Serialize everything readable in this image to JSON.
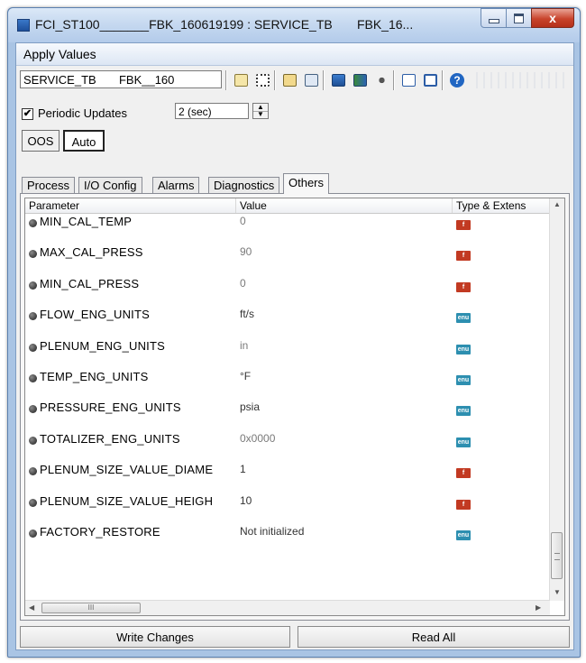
{
  "window": {
    "title": "FCI_ST100_______FBK_160619199 : SERVICE_TB       FBK_16...",
    "close_glyph": "x"
  },
  "menu": {
    "apply_values": "Apply Values"
  },
  "toolbar": {
    "block_name": "SERVICE_TB       FBK__160",
    "help_glyph": "?"
  },
  "periodic": {
    "checked_glyph": "✔",
    "label": "Periodic Updates",
    "interval": "2 (sec)"
  },
  "modes": {
    "oos": "OOS",
    "auto": "Auto"
  },
  "tabs": [
    "Process",
    "I/O Config",
    "Alarms",
    "Diagnostics",
    "Others"
  ],
  "active_tab": "Others",
  "grid": {
    "headers": {
      "parameter": "Parameter",
      "value": "Value",
      "type": "Type & Extens"
    },
    "rows": [
      {
        "name": "MIN_CAL_TEMP",
        "value": "0",
        "type": "f"
      },
      {
        "name": "MAX_CAL_PRESS",
        "value": "90",
        "type": "f"
      },
      {
        "name": "MIN_CAL_PRESS",
        "value": "0",
        "type": "f"
      },
      {
        "name": "FLOW_ENG_UNITS",
        "value": "ft/s",
        "type": "enu"
      },
      {
        "name": "PLENUM_ENG_UNITS",
        "value": "in",
        "type": "enu"
      },
      {
        "name": "TEMP_ENG_UNITS",
        "value": "°F",
        "type": "enu"
      },
      {
        "name": "PRESSURE_ENG_UNITS",
        "value": "psia",
        "type": "enu"
      },
      {
        "name": "TOTALIZER_ENG_UNITS",
        "value": "0x0000",
        "type": "enu"
      },
      {
        "name": "PLENUM_SIZE_VALUE_DIAME",
        "value": "1",
        "type": "f"
      },
      {
        "name": "PLENUM_SIZE_VALUE_HEIGH",
        "value": "10",
        "type": "f"
      },
      {
        "name": "FACTORY_RESTORE",
        "value": "Not initialized",
        "type": "enu"
      }
    ],
    "type_badges": {
      "f": "f",
      "enu": "enu"
    }
  },
  "scroll": {
    "hthumb_grip": "III"
  },
  "footer": {
    "write": "Write Changes",
    "read": "Read All"
  },
  "colors": {
    "float_badge": "#c23a22",
    "enum_badge": "#2d8fb0",
    "title_bar": "#c6d9f0"
  }
}
